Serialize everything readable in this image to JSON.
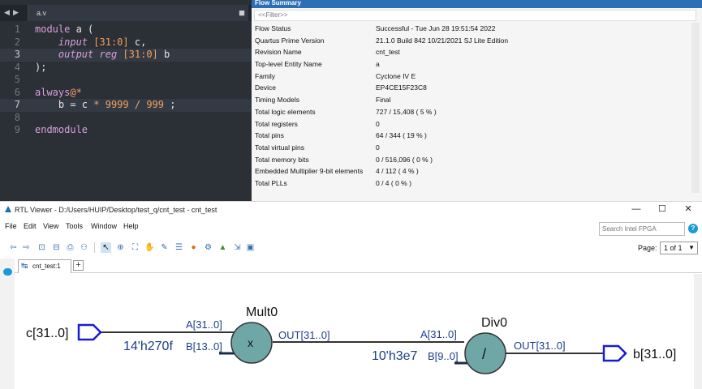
{
  "editor": {
    "tab_label": "a.v",
    "nav_left": "◀",
    "nav_right": "▶",
    "close": "■",
    "lines": [
      {
        "n": "1"
      },
      {
        "n": "2"
      },
      {
        "n": "3"
      },
      {
        "n": "4"
      },
      {
        "n": "5"
      },
      {
        "n": "6"
      },
      {
        "n": "7"
      },
      {
        "n": "8"
      },
      {
        "n": "9"
      }
    ],
    "tokens": {
      "l1_kw": "module",
      "l1_rest": " a (",
      "l2_io": "input",
      "l2_range": "[31:0]",
      "l2_rest": " c,",
      "l3_io": "output",
      "l3_reg": "reg",
      "l3_range": "[31:0]",
      "l3_rest": " b",
      "l4": ");",
      "l6_kw": "always",
      "l6_op": "@*",
      "l7_a": "b = c ",
      "l7_op": "*",
      "l7_n1": " 9999 ",
      "l7_div": "/",
      "l7_n2": " 999",
      "l7_end": " ;",
      "l9_kw": "endmodule"
    }
  },
  "flow_summary": {
    "title": "Flow Summary",
    "filter_placeholder": "<<Filter>>",
    "rows": [
      {
        "key": "Flow Status",
        "value": "Successful - Tue Jun 28 19:51:54 2022"
      },
      {
        "key": "Quartus Prime Version",
        "value": "21.1.0 Build 842 10/21/2021 SJ Lite Edition"
      },
      {
        "key": "Revision Name",
        "value": "cnt_test"
      },
      {
        "key": "Top-level Entity Name",
        "value": "a"
      },
      {
        "key": "Family",
        "value": "Cyclone IV E"
      },
      {
        "key": "Device",
        "value": "EP4CE15F23C8"
      },
      {
        "key": "Timing Models",
        "value": "Final"
      },
      {
        "key": "Total logic elements",
        "value": "727 / 15,408 ( 5 % )"
      },
      {
        "key": "Total registers",
        "value": "0"
      },
      {
        "key": "Total pins",
        "value": "64 / 344 ( 19 % )"
      },
      {
        "key": "Total virtual pins",
        "value": "0"
      },
      {
        "key": "Total memory bits",
        "value": "0 / 516,096 ( 0 % )"
      },
      {
        "key": "Embedded Multiplier 9-bit elements",
        "value": "4 / 112 ( 4 % )"
      },
      {
        "key": "Total PLLs",
        "value": "0 / 4 ( 0 % )"
      }
    ]
  },
  "rtl_viewer": {
    "window_title": "RTL Viewer - D:/Users/HUIP/Desktop/test_q/cnt_test - cnt_test",
    "window_buttons": {
      "minimize": "—",
      "maximize": "☐",
      "close": "✕"
    },
    "menu": {
      "file": "File",
      "edit": "Edit",
      "view": "View",
      "tools": "Tools",
      "window": "Window",
      "help": "Help"
    },
    "search_placeholder": "Search Intel FPGA",
    "help_glyph": "?",
    "page_label": "Page:",
    "page_value": "1 of 1",
    "tab_label": "cnt_test:1",
    "add_tab": "+",
    "colors": {
      "pin": "#1a1ad6",
      "node_fill": "#6fa7a7",
      "wire": "#333333",
      "port_text": "#1c3c8c"
    }
  },
  "schematic": {
    "input_pin": "c[31..0]",
    "output_pin": "b[31..0]",
    "mult": {
      "name": "Mult0",
      "symbol": "x",
      "port_a": "A[31..0]",
      "port_b": "B[13..0]",
      "out": "OUT[31..0]",
      "const": "14'h270f"
    },
    "div": {
      "name": "Div0",
      "symbol": "/",
      "port_a": "A[31..0]",
      "port_b": "B[9..0]",
      "out": "OUT[31..0]",
      "const": "10'h3e7"
    }
  }
}
